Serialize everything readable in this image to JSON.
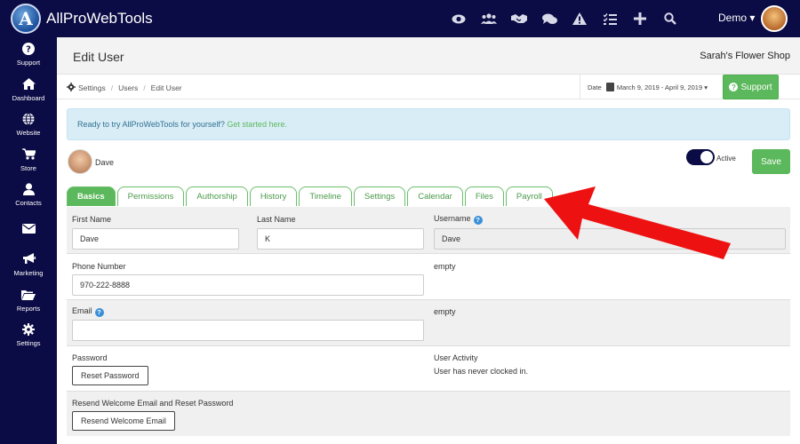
{
  "app": {
    "logo_letter": "A",
    "name": "AllProWebTools",
    "user_menu": "Demo ▾"
  },
  "top_icons": [
    "eye-icon",
    "users-icon",
    "handshake-icon",
    "comments-icon",
    "warning-icon",
    "tasks-icon",
    "plus-icon",
    "search-icon"
  ],
  "sidebar": {
    "items": [
      {
        "icon": "?",
        "label": "Support"
      },
      {
        "icon": "⌂",
        "label": "Dashboard"
      },
      {
        "icon": "◍",
        "label": "Website"
      },
      {
        "icon": "🛒",
        "label": "Store"
      },
      {
        "icon": "👤",
        "label": "Contacts"
      },
      {
        "icon": "✉",
        "label": ""
      },
      {
        "icon": "📣",
        "label": "Marketing"
      },
      {
        "icon": "📂",
        "label": "Reports"
      },
      {
        "icon": "⚙",
        "label": "Settings"
      }
    ]
  },
  "header": {
    "title": "Edit User",
    "shop_name": "Sarah's Flower Shop"
  },
  "breadcrumb": {
    "items": [
      "Settings",
      "Users",
      "Edit User"
    ]
  },
  "date_filter": {
    "label": "Date",
    "range": "March 9, 2019 - April 9, 2019 ▾"
  },
  "support_button": "Support",
  "alert": {
    "text": "Ready to try AllProWebTools for yourself? ",
    "link": "Get started here."
  },
  "user": {
    "name": "Dave",
    "active_label": "Active",
    "active": true
  },
  "save_button": "Save",
  "tabs": [
    {
      "label": "Basics",
      "active": true
    },
    {
      "label": "Permissions"
    },
    {
      "label": "Authorship"
    },
    {
      "label": "History"
    },
    {
      "label": "Timeline"
    },
    {
      "label": "Settings"
    },
    {
      "label": "Calendar"
    },
    {
      "label": "Files"
    },
    {
      "label": "Payroll"
    }
  ],
  "form": {
    "first_name_label": "First Name",
    "first_name": "Dave",
    "last_name_label": "Last Name",
    "last_name": "K",
    "username_label": "Username",
    "username": "Dave",
    "phone_label": "Phone Number",
    "phone": "970-222-8888",
    "phone_side": "empty",
    "email_label": "Email",
    "email": "",
    "email_side": "empty",
    "password_label": "Password",
    "reset_password": "Reset Password",
    "user_activity_label": "User Activity",
    "user_activity": "User has never clocked in.",
    "resend_label": "Resend Welcome Email and Reset Password",
    "resend_button": "Resend Welcome Email"
  },
  "colors": {
    "nav_bg": "#0b0b45",
    "accent_green": "#5cb85c",
    "alert_bg": "#d9edf7",
    "arrow_red": "#ee1111"
  }
}
